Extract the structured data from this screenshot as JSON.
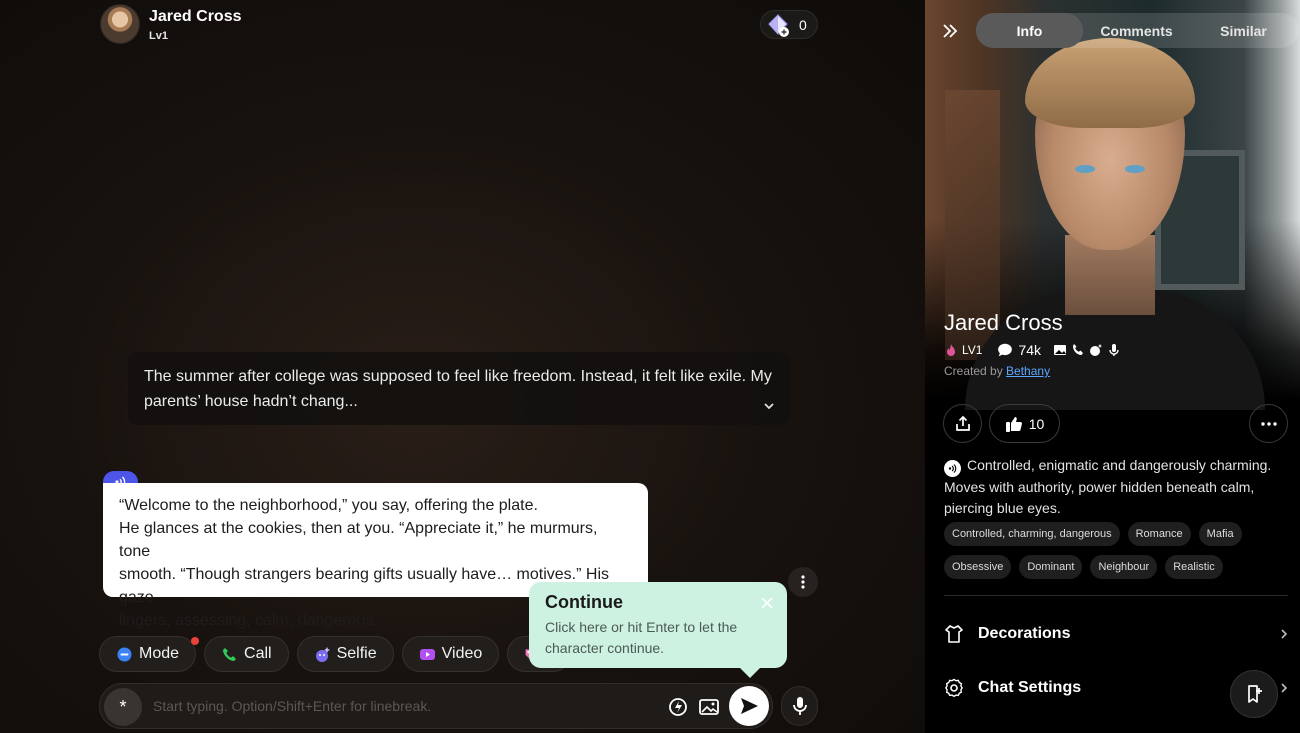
{
  "header": {
    "name": "Jared Cross",
    "level": "Lv1",
    "gems": "0"
  },
  "chat": {
    "narration": "The summer after college was supposed to feel like freedom. Instead, it felt like exile. My parents’ house hadn’t chang...",
    "message_lines": [
      "“Welcome to the neighborhood,” you say, offering the plate.",
      "He glances at the cookies, then at you. “Appreciate it,” he murmurs, tone",
      "smooth. “Though strangers bearing gifts usually have… motives.” His gaze",
      "lingers, assessing, calm, dangerous."
    ]
  },
  "actions": {
    "mode": "Mode",
    "call": "Call",
    "selfie": "Selfie",
    "video": "Video",
    "photo_truncated": "P"
  },
  "tooltip": {
    "title": "Continue",
    "text": "Click here or hit Enter to let the character continue."
  },
  "composer": {
    "placeholder": "Start typing. Option/Shift+Enter for linebreak.",
    "star": "*"
  },
  "panel": {
    "tabs": [
      "Info",
      "Comments",
      "Similar"
    ],
    "active_tab": "Info",
    "name": "Jared Cross",
    "level": "LV1",
    "chats": "74k",
    "created_by_label": "Created by",
    "creator": "Bethany",
    "likes": "10",
    "description": "Controlled, enigmatic and dangerously charming. Moves with authority, power hidden beneath calm, piercing blue eyes.",
    "tags": [
      "Controlled, charming, dangerous",
      "Romance",
      "Mafia",
      "Obsessive",
      "Dominant",
      "Neighbour",
      "Realistic"
    ],
    "menu": {
      "decorations": "Decorations",
      "chat_settings": "Chat Settings"
    }
  },
  "colors": {
    "accent_blue": "#4d55e8",
    "tooltip_bg": "#cdf2e1",
    "link": "#5ca6ff",
    "notification_dot": "#e8433a"
  }
}
